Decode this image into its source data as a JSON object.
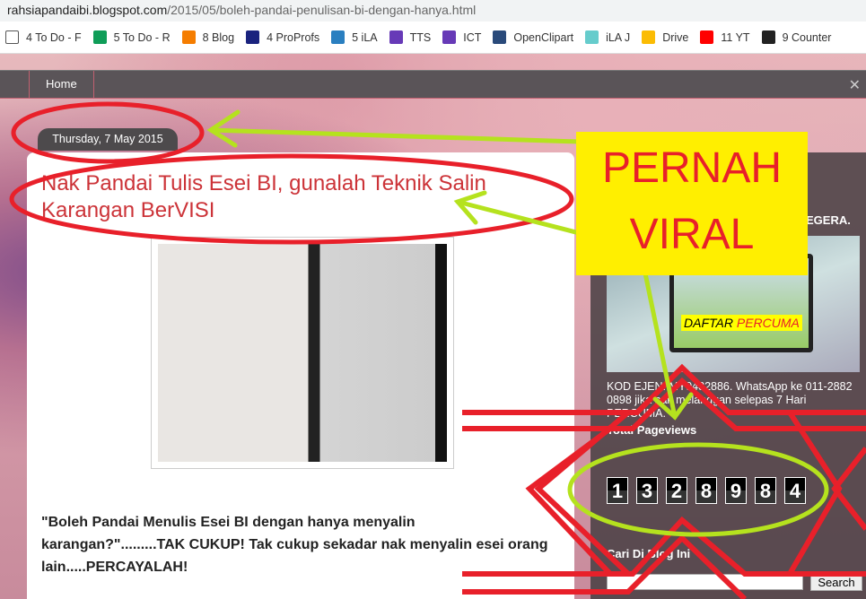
{
  "browser": {
    "url_domain": "rahsiapandaibi.blogspot.com",
    "url_path": "/2015/05/boleh-pandai-penulisan-bi-dengan-hanya.html",
    "bookmarks": [
      {
        "label": "4 To Do - F",
        "icon": "page-icon",
        "color": "#ffffff"
      },
      {
        "label": "5 To Do - R",
        "icon": "cross-icon",
        "color": "#0f9d58"
      },
      {
        "label": "8 Blog",
        "icon": "blogger-icon",
        "color": "#f57d00"
      },
      {
        "label": "4 ProProfs",
        "icon": "proprofs-icon",
        "color": "#1a237e"
      },
      {
        "label": "5 iLA",
        "icon": "globe-icon",
        "color": "#2a7fc0"
      },
      {
        "label": "TTS",
        "icon": "list-icon",
        "color": "#673ab7"
      },
      {
        "label": "ICT",
        "icon": "list-icon",
        "color": "#673ab7"
      },
      {
        "label": "OpenClipart",
        "icon": "scissors-icon",
        "color": "#2a4a7a"
      },
      {
        "label": "iLA J",
        "icon": "figure-icon",
        "color": "#6cc"
      },
      {
        "label": "Drive",
        "icon": "drive-icon",
        "color": "#fbbc04"
      },
      {
        "label": "11 YT",
        "icon": "youtube-icon",
        "color": "#ff0000"
      },
      {
        "label": "9 Counter",
        "icon": "w-icon",
        "color": "#222222"
      }
    ]
  },
  "nav": {
    "home": "Home"
  },
  "post": {
    "date": "Thursday, 7 May 2015",
    "title": "Nak Pandai Tulis Esei BI, gunalah Teknik Salin Karangan BerVISI",
    "body": "\"Boleh Pandai Menulis Esei BI dengan hanya menyalin karangan?\".........TAK CUKUP! Tak cukup sekadar nak menyalin esei orang lain.....PERCAYALAH!"
  },
  "sidebar": {
    "widget1_title": "EGERA.",
    "ad_label_1": "DAFTAR",
    "ad_label_2": "PERCUMA",
    "ad_desc": "KOD EJEN: MY9482886. WhatsApp ke 011-2882 0898 jika nak melanggan selepas 7 Hari PERCUMA.",
    "pageviews_title": "Total Pageviews",
    "pageviews_digits": [
      "1",
      "3",
      "2",
      "8",
      "9",
      "8",
      "4"
    ],
    "search_title": "Cari Di Blog Ini",
    "search_button": "Search"
  },
  "overlay": {
    "line1": "PERNAH",
    "line2": "VIRAL",
    "annotation_red": "#e8202a",
    "annotation_green": "#b5e21e",
    "highlight_yellow": "#ffef00"
  }
}
